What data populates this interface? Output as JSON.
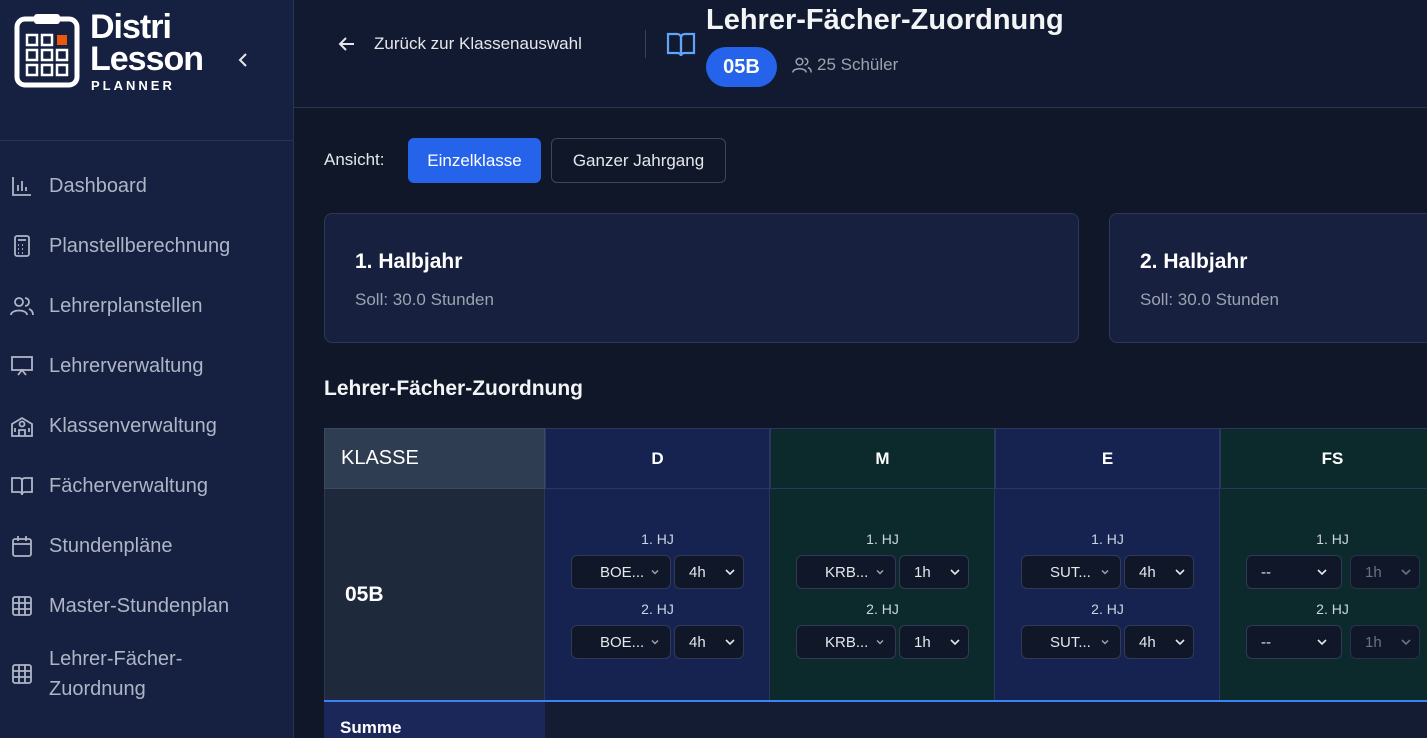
{
  "brand": {
    "line1": "Distri",
    "line2": "Lesson",
    "line3": "PLANNER"
  },
  "sidebar": {
    "items": [
      {
        "label": "Dashboard",
        "icon": "bar-chart-icon"
      },
      {
        "label": "Planstellberechnung",
        "icon": "calculator-icon"
      },
      {
        "label": "Lehrerplanstellen",
        "icon": "users-icon"
      },
      {
        "label": "Lehrerverwaltung",
        "icon": "presentation-icon"
      },
      {
        "label": "Klassenverwaltung",
        "icon": "school-icon"
      },
      {
        "label": "Fächerverwaltung",
        "icon": "book-icon"
      },
      {
        "label": "Stundenpläne",
        "icon": "calendar-icon"
      },
      {
        "label": "Master-Stundenplan",
        "icon": "grid-icon"
      },
      {
        "label": "Lehrer-Fächer-Zuordnung",
        "icon": "grid-icon"
      }
    ]
  },
  "header": {
    "back_label": "Zurück zur Klassenauswahl",
    "title": "Lehrer-Fächer-Zuordnung",
    "class_badge": "05B",
    "students": "25 Schüler"
  },
  "view": {
    "label": "Ansicht:",
    "single": "Einzelklasse",
    "year": "Ganzer Jahrgang"
  },
  "semesters": [
    {
      "title": "1. Halbjahr",
      "soll": "Soll: 30.0 Stunden"
    },
    {
      "title": "2. Halbjahr",
      "soll": "Soll: 30.0 Stunden"
    }
  ],
  "section_title": "Lehrer-Fächer-Zuordnung",
  "table": {
    "class_header": "KLASSE",
    "class_name": "05B",
    "sum_label": "Summe",
    "subjects": [
      {
        "name": "D",
        "hj1_label": "1. HJ",
        "hj2_label": "2. HJ",
        "hj1_teacher": "BOE...",
        "hj1_hours": "4h",
        "hj2_teacher": "BOE...",
        "hj2_hours": "4h"
      },
      {
        "name": "M",
        "hj1_label": "1. HJ",
        "hj2_label": "2. HJ",
        "hj1_teacher": "KRB...",
        "hj1_hours": "1h",
        "hj2_teacher": "KRB...",
        "hj2_hours": "1h"
      },
      {
        "name": "E",
        "hj1_label": "1. HJ",
        "hj2_label": "2. HJ",
        "hj1_teacher": "SUT...",
        "hj1_hours": "4h",
        "hj2_teacher": "SUT...",
        "hj2_hours": "4h"
      },
      {
        "name": "FS",
        "hj1_label": "1. HJ",
        "hj2_label": "2. HJ",
        "hj1_teacher": "--",
        "hj1_hours": "1h",
        "hj2_teacher": "--",
        "hj2_hours": "1h"
      }
    ]
  },
  "colors": {
    "accent": "#2563eb",
    "subject_blue": "#162350",
    "subject_green": "#0c2a2c"
  }
}
